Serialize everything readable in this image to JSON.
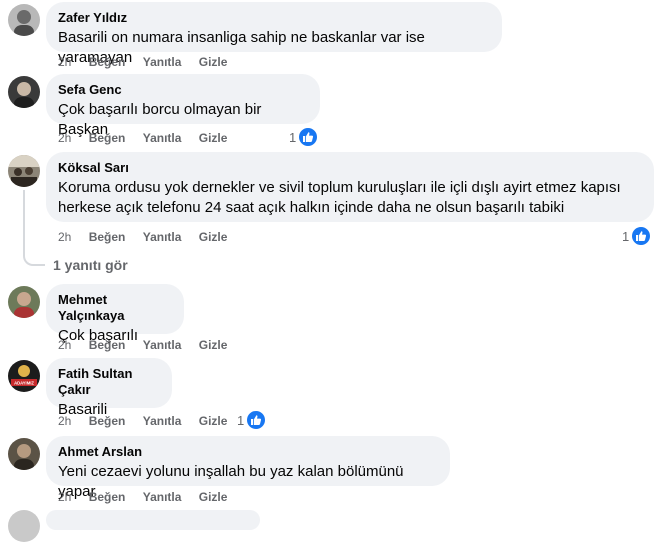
{
  "comments": [
    {
      "author": "Zafer Yıldız",
      "text": "Basarili on numara insanliga sahip ne baskanlar var ise yaramayan",
      "time": "2h",
      "like": "Beğen",
      "reply": "Yanıtla",
      "hide": "Gizle",
      "reactions": ""
    },
    {
      "author": "Sefa Genc",
      "text": "Çok başarılı borcu olmayan bir Başkan",
      "time": "2h",
      "like": "Beğen",
      "reply": "Yanıtla",
      "hide": "Gizle",
      "reactions": "1"
    },
    {
      "author": "Köksal Sarı",
      "text": "Koruma ordusu yok dernekler ve sivil toplum kuruluşları ile içli dışlı ayirt etmez kapısı herkese açık telefonu 24 saat açık halkın içinde daha ne olsun başarılı tabiki",
      "time": "2h",
      "like": "Beğen",
      "reply": "Yanıtla",
      "hide": "Gizle",
      "reactions": "1",
      "view_replies": "1 yanıtı gör"
    },
    {
      "author": "Mehmet Yalçınkaya",
      "text": "Çok başarılı",
      "time": "2h",
      "like": "Beğen",
      "reply": "Yanıtla",
      "hide": "Gizle",
      "reactions": ""
    },
    {
      "author": "Fatih Sultan Çakır",
      "text": "Basarili",
      "time": "2h",
      "like": "Beğen",
      "reply": "Yanıtla",
      "hide": "Gizle",
      "reactions": "1",
      "avatar_text": "ADAYIMIZ"
    },
    {
      "author": "Ahmet Arslan",
      "text": "Yeni cezaevi yolunu inşallah bu yaz kalan bölümünü yapar",
      "time": "2h",
      "like": "Beğen",
      "reply": "Yanıtla",
      "hide": "Gizle",
      "reactions": ""
    }
  ],
  "colors": {
    "like_blue": "#1877f2",
    "bubble": "#f0f2f5",
    "meta": "#65676b"
  }
}
